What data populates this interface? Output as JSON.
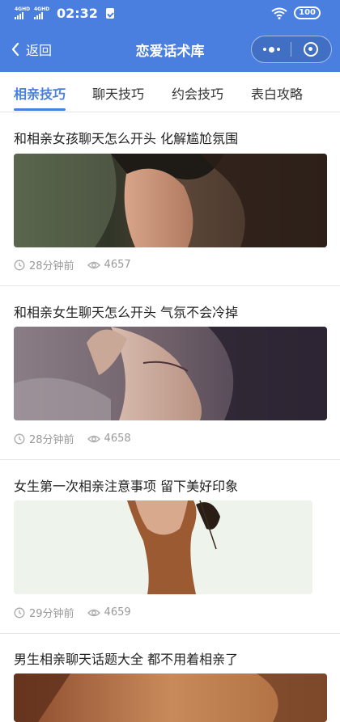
{
  "status_bar": {
    "signal1": "4GHD",
    "signal2": "4GHD",
    "time": "02:32",
    "battery": "100"
  },
  "nav": {
    "back_label": "返回",
    "title": "恋爱话术库"
  },
  "tabs": [
    {
      "label": "相亲技巧",
      "active": true
    },
    {
      "label": "聊天技巧",
      "active": false
    },
    {
      "label": "约会技巧",
      "active": false
    },
    {
      "label": "表白攻略",
      "active": false
    }
  ],
  "articles": [
    {
      "title": "和相亲女孩聊天怎么开头 化解尴尬氛围",
      "time": "28分钟前",
      "views": "4657"
    },
    {
      "title": "和相亲女生聊天怎么开头 气氛不会冷掉",
      "time": "28分钟前",
      "views": "4658"
    },
    {
      "title": "女生第一次相亲注意事项 留下美好印象",
      "time": "29分钟前",
      "views": "4659"
    },
    {
      "title": "男生相亲聊天话题大全 都不用着相亲了"
    }
  ],
  "colors": {
    "accent": "#4a7fe0"
  },
  "icons": [
    "back-arrow-icon",
    "more-icon",
    "close-miniapp-icon",
    "clock-icon",
    "eye-icon",
    "wifi-icon",
    "battery-icon",
    "signal-icon",
    "sim-icon"
  ]
}
